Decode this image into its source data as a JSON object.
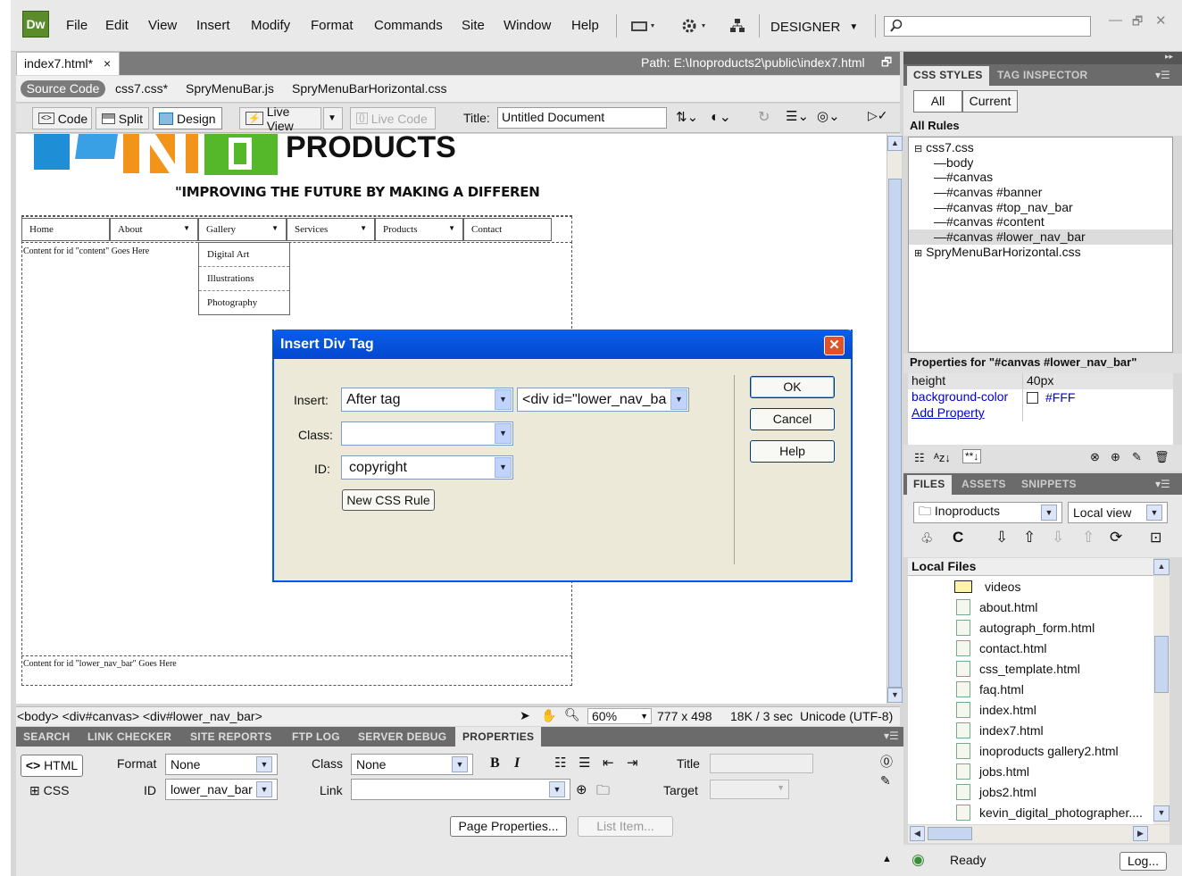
{
  "app": {
    "logo_text": "Dw",
    "workspace": "DESIGNER"
  },
  "menu": [
    "File",
    "Edit",
    "View",
    "Insert",
    "Modify",
    "Format",
    "Commands",
    "Site",
    "Window",
    "Help"
  ],
  "document": {
    "tab_label": "index7.html*",
    "path": "Path: E:\\Inoproducts2\\public\\index7.html",
    "related_files": [
      "Source Code",
      "css7.css*",
      "SpryMenuBar.js",
      "SpryMenuBarHorizontal.css"
    ],
    "views": {
      "code": "Code",
      "split": "Split",
      "design": "Design",
      "live_view": "Live View",
      "live_code": "Live Code"
    },
    "title_label": "Title:",
    "title_value": "Untitled Document"
  },
  "page": {
    "brand": "PRODUCTS",
    "tagline": "\"IMPROVING THE FUTURE BY MAKING A DIFFEREN",
    "nav": [
      "Home",
      "About",
      "Gallery",
      "Services",
      "Products",
      "Contact"
    ],
    "gallery_submenu": [
      "Digital Art",
      "Illustrations",
      "Photography"
    ],
    "content_placeholder": "Content for id \"content\" Goes Here",
    "lower_nav_placeholder": "Content for id \"lower_nav_bar\" Goes Here"
  },
  "status": {
    "tag_selector": "<body> <div#canvas> <div#lower_nav_bar>",
    "zoom": "60%",
    "dimensions": "777 x 498",
    "download": "18K / 3 sec",
    "encoding": "Unicode (UTF-8)"
  },
  "bottom_tabs": [
    "SEARCH",
    "LINK CHECKER",
    "SITE REPORTS",
    "FTP LOG",
    "SERVER DEBUG",
    "PROPERTIES"
  ],
  "properties": {
    "html_btn": "HTML",
    "css_btn": "CSS",
    "format_label": "Format",
    "format_value": "None",
    "class_label": "Class",
    "class_value": "None",
    "id_label": "ID",
    "id_value": "lower_nav_bar",
    "link_label": "Link",
    "title_label": "Title",
    "target_label": "Target",
    "page_props": "Page Properties...",
    "list_item": "List Item..."
  },
  "css_panel": {
    "tabs": [
      "CSS STYLES",
      "TAG INSPECTOR"
    ],
    "modes": [
      "All",
      "Current"
    ],
    "section": "All Rules",
    "rules": [
      "css7.css",
      "body",
      "#canvas",
      "#canvas #banner",
      "#canvas #top_nav_bar",
      "#canvas #content",
      "#canvas #lower_nav_bar",
      "SpryMenuBarHorizontal.css"
    ],
    "props_header": "Properties for \"#canvas #lower_nav_bar\"",
    "props": [
      {
        "name": "height",
        "value": "40px"
      },
      {
        "name": "background-color",
        "value": "#FFF"
      }
    ],
    "add_property": "Add Property"
  },
  "files_panel": {
    "tabs": [
      "FILES",
      "ASSETS",
      "SNIPPETS"
    ],
    "site": "Inoproducts",
    "view": "Local view",
    "section": "Local Files",
    "items": [
      "videos",
      "about.html",
      "autograph_form.html",
      "contact.html",
      "css_template.html",
      "faq.html",
      "index.html",
      "index7.html",
      "inoproducts gallery2.html",
      "jobs.html",
      "jobs2.html",
      "kevin_digital_photographer...."
    ],
    "status": "Ready",
    "log_btn": "Log..."
  },
  "dialog": {
    "title": "Insert Div Tag",
    "insert_label": "Insert:",
    "insert_value": "After tag",
    "tag_value": "<div id=\"lower_nav_ba",
    "class_label": "Class:",
    "class_value": "",
    "id_label": "ID:",
    "id_value": "copyright",
    "new_css_rule": "New CSS Rule",
    "ok": "OK",
    "cancel": "Cancel",
    "help": "Help"
  }
}
